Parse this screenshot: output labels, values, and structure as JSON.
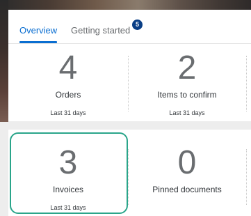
{
  "tabs": [
    {
      "label": "Overview",
      "active": true
    },
    {
      "label": "Getting started",
      "badge": "5"
    }
  ],
  "top_tiles": [
    {
      "value": "4",
      "label": "Orders",
      "sub": "Last 31 days"
    },
    {
      "value": "2",
      "label": "Items to confirm",
      "sub": "Last 31 days"
    }
  ],
  "bottom_tiles": [
    {
      "value": "3",
      "label": "Invoices",
      "sub": "Last 31 days",
      "highlighted": true
    },
    {
      "value": "0",
      "label": "Pinned documents",
      "sub": ""
    }
  ],
  "colors": {
    "accent": "#0a6ed1",
    "badge": "#0a3f86",
    "highlight": "#2aa58a"
  }
}
